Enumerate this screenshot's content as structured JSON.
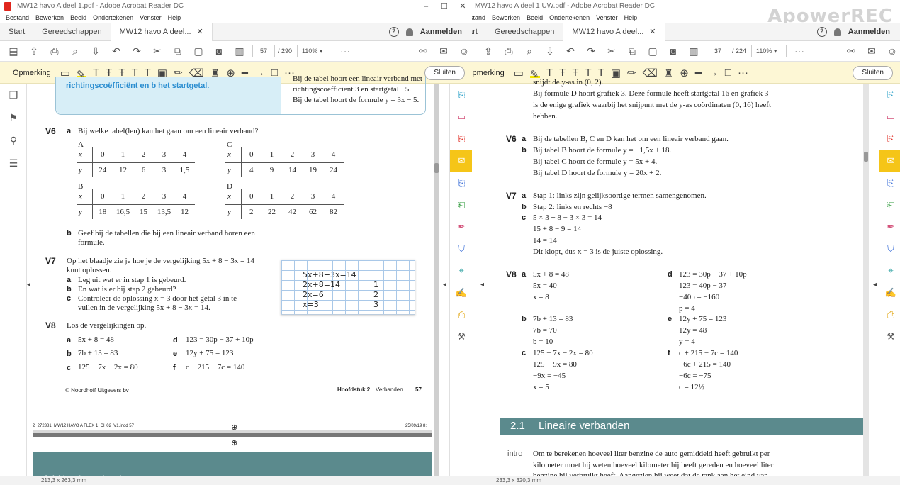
{
  "left": {
    "title": "MW12 havo A deel 1.pdf - Adobe Acrobat Reader DC",
    "menu": [
      "Bestand",
      "Bewerken",
      "Beeld",
      "Ondertekenen",
      "Venster",
      "Help"
    ],
    "tabs": {
      "start": "Start",
      "tools": "Gereedschappen",
      "doc": "MW12 havo A deel..."
    },
    "signin": "Aanmelden",
    "page_num": "57",
    "page_total": "/ 290",
    "zoom": "110%",
    "comment_label": "Opmerking",
    "close_label": "Sluiten",
    "status": "213,3 x 263,3 mm",
    "top_box_left": "richtingscoëfficiënt en b het startgetal.",
    "top_box_right": [
      "Bij de tabel hoort een lineair verband met",
      "richtingscoëfficiënt 3 en startgetal −5.",
      "Bij de tabel hoort de formule y = 3x − 5."
    ],
    "v6": {
      "num": "V6",
      "a": "Bij welke tabel(len) kan het gaan om een lineair verband?",
      "tables": [
        {
          "name": "A",
          "x": [
            "x",
            "0",
            "1",
            "2",
            "3",
            "4"
          ],
          "y": [
            "y",
            "24",
            "12",
            "6",
            "3",
            "1,5"
          ]
        },
        {
          "name": "C",
          "x": [
            "x",
            "0",
            "1",
            "2",
            "3",
            "4"
          ],
          "y": [
            "y",
            "4",
            "9",
            "14",
            "19",
            "24"
          ]
        },
        {
          "name": "B",
          "x": [
            "x",
            "0",
            "1",
            "2",
            "3",
            "4"
          ],
          "y": [
            "y",
            "18",
            "16,5",
            "15",
            "13,5",
            "12"
          ]
        },
        {
          "name": "D",
          "x": [
            "x",
            "0",
            "1",
            "2",
            "3",
            "4"
          ],
          "y": [
            "y",
            "2",
            "22",
            "42",
            "62",
            "82"
          ]
        }
      ],
      "b1": "Geef bij de tabellen die bij een lineair verband horen een",
      "b2": "formule."
    },
    "v7": {
      "num": "V7",
      "intro1": "Op het blaadje zie je hoe je de vergelijking 5x + 8 − 3x = 14",
      "intro2": "kunt oplossen.",
      "a": "Leg uit wat er in stap 1 is gebeurd.",
      "b": "En wat is er bij stap 2 gebeurd?",
      "c1": "Controleer de oplossing x = 3 door het getal 3 in te",
      "c2": "vullen in de vergelijking 5x + 8 − 3x = 14.",
      "hand": [
        "5x+8−3x=14",
        "2x+8=14",
        "2x=6",
        "x=3"
      ],
      "hand_r": [
        "1",
        "2",
        "3"
      ]
    },
    "v8": {
      "num": "V8",
      "intro": "Los de vergelijkingen op.",
      "a": "5x + 8 = 48",
      "b": "7b + 13 = 83",
      "c": "125 − 7x − 2x = 80",
      "d": "123 = 30p − 37 + 10p",
      "e": "12y + 75 = 123",
      "f": "c + 215 − 7c = 140"
    },
    "footer_left": "© Noordhoff Uitgevers bv",
    "footer_right_b": "Hoofdstuk 2",
    "footer_right": "Verbanden",
    "footer_page": "57",
    "print_line_l": "2_272381_MW12 HAVO A FLEX 1_CH02_V1.indd 57",
    "print_line_r": "25/09/19 8:",
    "next_band": "2.1 Lineaire verbanden"
  },
  "right": {
    "title": "MW12 havo A deel 1 UW.pdf - Adobe Acrobat Reader DC",
    "menu": [
      "Bestand",
      "Bewerken",
      "Beeld",
      "Ondertekenen",
      "Venster",
      "Help"
    ],
    "tabs": {
      "tools": "Gereedschappen",
      "doc": "MW12 havo A deel..."
    },
    "signin": "Aanmelden",
    "page_num": "37",
    "page_total": "/ 224",
    "zoom": "110%",
    "comment_label": "Opmerking",
    "close_label": "Sluiten",
    "status": "233,3 x 320,3 mm",
    "watermark": "ApowerREC",
    "top_line0": "snijdt de y-as in (0, 2).",
    "top_lines": [
      "Bij formule D hoort grafiek 3. Deze formule heeft startgetal 16 en grafiek 3",
      "is de enige grafiek waarbij het snijpunt met de y-as coördinaten (0, 16) heeft",
      "hebben."
    ],
    "v6": {
      "num": "V6",
      "a": "Bij de tabellen B, C en D kan het om een lineair verband gaan.",
      "b1": "Bij tabel B hoort de formule y = −1,5x + 18.",
      "b2": "Bij tabel C hoort de formule y = 5x + 4.",
      "b3": "Bij tabel D hoort de formule y = 20x + 2."
    },
    "v7": {
      "num": "V7",
      "a": "Stap 1: links zijn gelijksoortige termen samengenomen.",
      "b": "Stap 2: links en rechts −8",
      "c": [
        "5 × 3 + 8 − 3 × 3 = 14",
        "15 + 8 − 9 = 14",
        "14 = 14",
        "Dit klopt, dus x = 3 is de juiste oplossing."
      ]
    },
    "v8": {
      "num": "V8",
      "a": [
        "5x + 8 = 48",
        "5x = 40",
        "x = 8"
      ],
      "b": [
        "7b + 13 = 83",
        "7b = 70",
        "b = 10"
      ],
      "c": [
        "125 − 7x − 2x = 80",
        "125 − 9x = 80",
        "−9x = −45",
        "x = 5"
      ],
      "d": [
        "123 = 30p − 37 + 10p",
        "123 = 40p − 37",
        "−40p = −160",
        "p = 4"
      ],
      "e": [
        "12y + 75 = 123",
        "12y = 48",
        "y = 4"
      ],
      "f": [
        "c + 215 − 7c = 140",
        "−6c + 215 = 140",
        "−6c = −75",
        "c = 12½"
      ]
    },
    "section": {
      "num": "2.1",
      "title": "Lineaire verbanden"
    },
    "intro_label": "intro",
    "intro_lines": [
      "Om te berekenen hoeveel liter benzine de auto gemiddeld heeft gebruikt per",
      "kilometer moet hij weten hoeveel kilometer hij heeft gereden en hoeveel liter",
      "benzine hij verbruikt heeft. Aangezien hij weet dat de tank aan het eind van"
    ]
  },
  "letters": {
    "a": "a",
    "b": "b",
    "c": "c",
    "d": "d",
    "e": "e",
    "f": "f"
  }
}
